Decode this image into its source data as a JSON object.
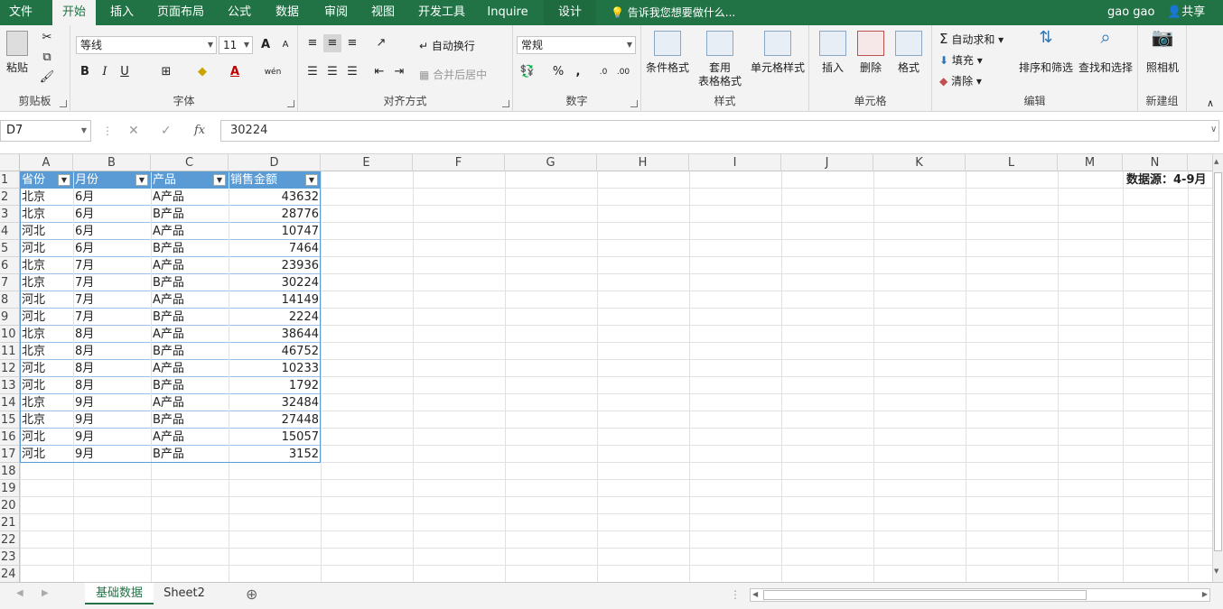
{
  "menu": {
    "tabs": [
      "文件",
      "开始",
      "插入",
      "页面布局",
      "公式",
      "数据",
      "审阅",
      "视图",
      "开发工具",
      "Inquire",
      "设计"
    ],
    "tell_me": "告诉我您想要做什么...",
    "user": "gao gao",
    "share": "共享"
  },
  "ribbon": {
    "clipboard": {
      "label": "剪贴板",
      "paste": "粘贴"
    },
    "font": {
      "label": "字体",
      "name": "等线",
      "size": "11",
      "bold": "B",
      "italic": "I",
      "underline": "U",
      "grow": "A",
      "shrink": "A",
      "font_color": "A",
      "phonetic": "wén"
    },
    "alignment": {
      "label": "对齐方式",
      "wrap": "自动换行",
      "merge": "合并后居中"
    },
    "number": {
      "label": "数字",
      "format": "常规",
      "percent": "%",
      "comma": ","
    },
    "styles": {
      "label": "样式",
      "conditional": "条件格式",
      "table_l1": "套用",
      "table_l2": "表格格式",
      "cell_styles": "单元格样式"
    },
    "cells": {
      "label": "单元格",
      "insert": "插入",
      "delete": "删除",
      "format": "格式"
    },
    "editing": {
      "label": "编辑",
      "autosum": "自动求和",
      "fill": "填充",
      "clear": "清除",
      "sort": "排序和筛选",
      "find": "查找和选择"
    },
    "newgroup": {
      "label": "新建组",
      "camera": "照相机"
    }
  },
  "formula_bar": {
    "name_box": "D7",
    "fx": "fx",
    "value": "30224"
  },
  "columns": [
    "A",
    "B",
    "C",
    "D",
    "E",
    "F",
    "G",
    "H",
    "I",
    "J",
    "K",
    "L",
    "M",
    "N"
  ],
  "row_numbers": [
    "1",
    "2",
    "3",
    "4",
    "5",
    "6",
    "7",
    "8",
    "9",
    "10",
    "11",
    "12",
    "13",
    "14",
    "15",
    "16",
    "17",
    "18",
    "19",
    "20",
    "21",
    "22",
    "23",
    "24"
  ],
  "table": {
    "headers": [
      "省份",
      "月份",
      "产品",
      "销售金额"
    ],
    "rows": [
      [
        "北京",
        "6月",
        "A产品",
        "43632"
      ],
      [
        "北京",
        "6月",
        "B产品",
        "28776"
      ],
      [
        "河北",
        "6月",
        "A产品",
        "10747"
      ],
      [
        "河北",
        "6月",
        "B产品",
        "7464"
      ],
      [
        "北京",
        "7月",
        "A产品",
        "23936"
      ],
      [
        "北京",
        "7月",
        "B产品",
        "30224"
      ],
      [
        "河北",
        "7月",
        "A产品",
        "14149"
      ],
      [
        "河北",
        "7月",
        "B产品",
        "2224"
      ],
      [
        "北京",
        "8月",
        "A产品",
        "38644"
      ],
      [
        "北京",
        "8月",
        "B产品",
        "46752"
      ],
      [
        "河北",
        "8月",
        "A产品",
        "10233"
      ],
      [
        "河北",
        "8月",
        "B产品",
        "1792"
      ],
      [
        "北京",
        "9月",
        "A产品",
        "32484"
      ],
      [
        "北京",
        "9月",
        "B产品",
        "27448"
      ],
      [
        "河北",
        "9月",
        "A产品",
        "15057"
      ],
      [
        "河北",
        "9月",
        "B产品",
        "3152"
      ]
    ]
  },
  "note_n1": "数据源：4-9月",
  "sheets": {
    "tabs": [
      "基础数据",
      "Sheet2"
    ],
    "active": "基础数据"
  },
  "colors": {
    "accent": "#217346",
    "table_header": "#5b9bd5"
  }
}
